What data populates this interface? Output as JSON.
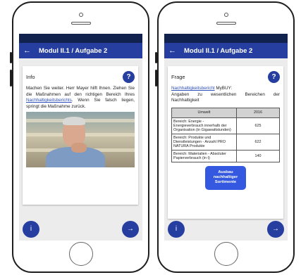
{
  "left": {
    "title": "Modul II.1 / Aufgabe 2",
    "back_icon": "←",
    "card_title": "Info",
    "help_label": "?",
    "text_before_link": "Machen Sie weiter. Herr Mayer hilft Ihnen. Ziehen Sie die Maßnahmen auf den richtigen Bereich Ihres ",
    "link_text": "Nachhaltigkeitsberichts",
    "text_after_link": ". Wenn Sie falsch liegen, springt die Maßnahme zurück.",
    "info_label": "i",
    "next_label": "→"
  },
  "right": {
    "title": "Modul II.1 / Aufgabe 2",
    "back_icon": "←",
    "card_title": "Frage",
    "help_label": "?",
    "link_text": "Nachhaltigkeitsbericht",
    "text_after_link": " MyBUY:",
    "subtitle": "Angaben zu wesentlichen Bereichen der Nachhaltigkeit",
    "table": {
      "headers": [
        "Umwelt",
        "2016"
      ],
      "rows": [
        {
          "label": "Bereich: Energie - Energieverbrauch innerhalb der Organisation (in Gigawattstunden)",
          "value": "625"
        },
        {
          "label": "Bereich: Produkte und Dienstleistungen - Anzahl PRO NATURA Produkte",
          "value": "622"
        },
        {
          "label": "Bereich: Materialien - Absoluter Papierverbrauch (in t)",
          "value": "140"
        }
      ]
    },
    "action_line1": "Ausbau",
    "action_line2": "nachhaltiger",
    "action_line3": "Sortimente",
    "info_label": "i",
    "next_label": "→"
  },
  "colors": {
    "app_bar": "#253ea0",
    "status_bar": "#11224e",
    "action_button": "#3459e0",
    "link": "#2d4fb8"
  }
}
